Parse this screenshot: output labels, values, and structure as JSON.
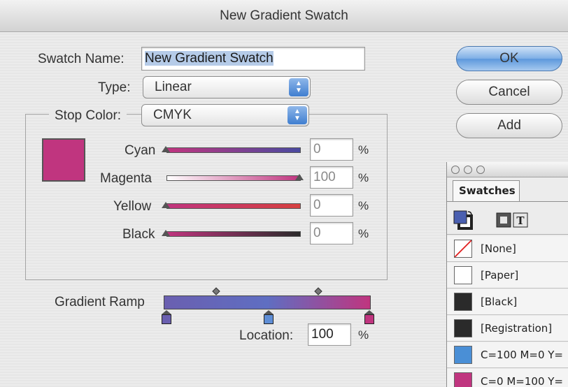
{
  "window": {
    "title": "New Gradient Swatch"
  },
  "form": {
    "swatch_name_label": "Swatch Name:",
    "swatch_name_value": "New Gradient Swatch",
    "type_label": "Type:",
    "type_value": "Linear",
    "stop_color_label": "Stop Color:",
    "stop_color_value": "CMYK"
  },
  "buttons": {
    "ok": "OK",
    "cancel": "Cancel",
    "add": "Add"
  },
  "sliders": [
    {
      "label": "Cyan",
      "value": "0",
      "unit": "%"
    },
    {
      "label": "Magenta",
      "value": "100",
      "unit": "%"
    },
    {
      "label": "Yellow",
      "value": "0",
      "unit": "%"
    },
    {
      "label": "Black",
      "value": "0",
      "unit": "%"
    }
  ],
  "gradient": {
    "ramp_label": "Gradient Ramp",
    "location_label": "Location:",
    "location_value": "100",
    "location_unit": "%",
    "stop_color": "#c0357f",
    "start_color": "#6a5fb0"
  },
  "swatches_panel": {
    "tab_label": "Swatches",
    "items": [
      {
        "name": "[None]",
        "color": "none"
      },
      {
        "name": "[Paper]",
        "color": "#ffffff"
      },
      {
        "name": "[Black]",
        "color": "#2a2a2a"
      },
      {
        "name": "[Registration]",
        "color": "#2a2a2a"
      },
      {
        "name": "C=100 M=0 Y=",
        "color": "#4a8fd6"
      },
      {
        "name": "C=0 M=100 Y=",
        "color": "#c0357f"
      }
    ]
  }
}
